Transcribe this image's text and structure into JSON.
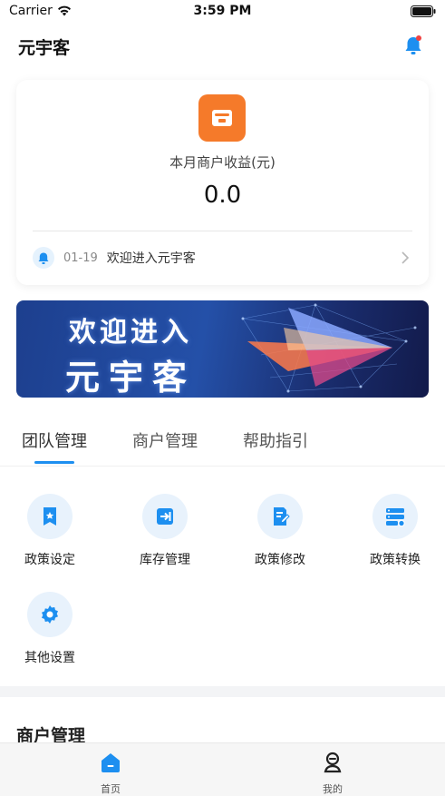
{
  "status_bar": {
    "carrier": "Carrier",
    "time": "3:59 PM"
  },
  "nav": {
    "title": "元宇客"
  },
  "income_card": {
    "label": "本月商户收益(元)",
    "value": "0.0",
    "notice": {
      "date": "01-19",
      "text": "欢迎进入元宇客"
    }
  },
  "banner": {
    "line1": "欢迎进入",
    "line2": "元宇客"
  },
  "tabs": [
    {
      "label": "团队管理",
      "active": true
    },
    {
      "label": "商户管理",
      "active": false
    },
    {
      "label": "帮助指引",
      "active": false
    }
  ],
  "grid": [
    {
      "label": "政策设定",
      "icon": "bookmark-star-icon"
    },
    {
      "label": "库存管理",
      "icon": "inventory-in-icon"
    },
    {
      "label": "政策修改",
      "icon": "edit-document-icon"
    },
    {
      "label": "政策转换",
      "icon": "server-convert-icon"
    },
    {
      "label": "其他设置",
      "icon": "gear-icon"
    }
  ],
  "merchant_section": {
    "title": "商户管理"
  },
  "tabbar": [
    {
      "label": "首页",
      "icon": "home-icon",
      "active": true
    },
    {
      "label": "我的",
      "icon": "user-icon",
      "active": false
    }
  ],
  "colors": {
    "accent": "#1d8ff0",
    "orange": "#f57a2a",
    "icon_bg": "#e8f2fc"
  }
}
